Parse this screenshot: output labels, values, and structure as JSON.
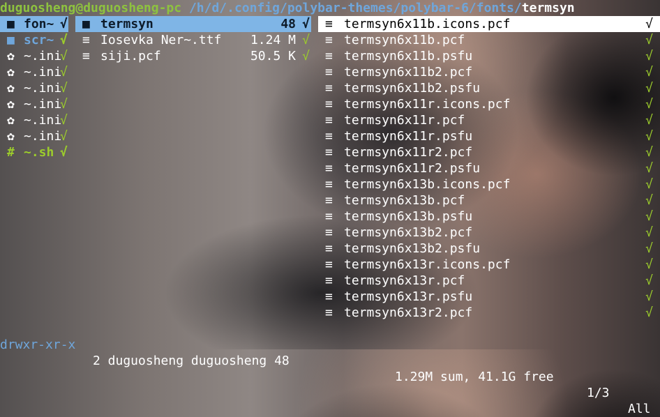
{
  "titlebar": {
    "user_host": "duguosheng@duguosheng-pc",
    "path": "/h/d/.config/polybar-themes/polybar-6/fonts/",
    "current": "termsyn"
  },
  "icons": {
    "folder": "folder-icon",
    "file": "file-icon",
    "gear": "gear-icon",
    "check": "check-icon"
  },
  "parent_column": [
    {
      "icon": "■",
      "name": "fon~",
      "check": "√",
      "kind": "dir hl"
    },
    {
      "icon": "■",
      "name": "scr~",
      "check": "√",
      "kind": "dir"
    },
    {
      "icon": "✿",
      "name": "~.ini",
      "check": "√",
      "kind": "ini"
    },
    {
      "icon": "✿",
      "name": "~.ini",
      "check": "√",
      "kind": "ini"
    },
    {
      "icon": "✿",
      "name": "~.ini",
      "check": "√",
      "kind": "ini"
    },
    {
      "icon": "✿",
      "name": "~.ini",
      "check": "√",
      "kind": "ini"
    },
    {
      "icon": "✿",
      "name": "~.ini",
      "check": "√",
      "kind": "ini"
    },
    {
      "icon": "✿",
      "name": "~.ini",
      "check": "√",
      "kind": "ini"
    },
    {
      "icon": "#",
      "name": "~.sh",
      "check": "√",
      "kind": "sh"
    }
  ],
  "current_column": [
    {
      "icon": "■",
      "name": "termsyn",
      "size": "48",
      "check": "√",
      "kind": "dir hl"
    },
    {
      "icon": "≡",
      "name": "Iosevka Ner~.ttf",
      "size": "1.24 M",
      "check": "√",
      "kind": "file"
    },
    {
      "icon": "≡",
      "name": "siji.pcf",
      "size": "50.5 K",
      "check": "√",
      "kind": "file"
    }
  ],
  "preview_column": [
    {
      "icon": "≡",
      "name": "termsyn6x11b.icons.pcf",
      "check": "√",
      "kind": "sel"
    },
    {
      "icon": "≡",
      "name": "termsyn6x11b.pcf",
      "check": "√",
      "kind": "file"
    },
    {
      "icon": "≡",
      "name": "termsyn6x11b.psfu",
      "check": "√",
      "kind": "file"
    },
    {
      "icon": "≡",
      "name": "termsyn6x11b2.pcf",
      "check": "√",
      "kind": "file"
    },
    {
      "icon": "≡",
      "name": "termsyn6x11b2.psfu",
      "check": "√",
      "kind": "file"
    },
    {
      "icon": "≡",
      "name": "termsyn6x11r.icons.pcf",
      "check": "√",
      "kind": "file"
    },
    {
      "icon": "≡",
      "name": "termsyn6x11r.pcf",
      "check": "√",
      "kind": "file"
    },
    {
      "icon": "≡",
      "name": "termsyn6x11r.psfu",
      "check": "√",
      "kind": "file"
    },
    {
      "icon": "≡",
      "name": "termsyn6x11r2.pcf",
      "check": "√",
      "kind": "file"
    },
    {
      "icon": "≡",
      "name": "termsyn6x11r2.psfu",
      "check": "√",
      "kind": "file"
    },
    {
      "icon": "≡",
      "name": "termsyn6x13b.icons.pcf",
      "check": "√",
      "kind": "file"
    },
    {
      "icon": "≡",
      "name": "termsyn6x13b.pcf",
      "check": "√",
      "kind": "file"
    },
    {
      "icon": "≡",
      "name": "termsyn6x13b.psfu",
      "check": "√",
      "kind": "file"
    },
    {
      "icon": "≡",
      "name": "termsyn6x13b2.pcf",
      "check": "√",
      "kind": "file"
    },
    {
      "icon": "≡",
      "name": "termsyn6x13b2.psfu",
      "check": "√",
      "kind": "file"
    },
    {
      "icon": "≡",
      "name": "termsyn6x13r.icons.pcf",
      "check": "√",
      "kind": "file"
    },
    {
      "icon": "≡",
      "name": "termsyn6x13r.pcf",
      "check": "√",
      "kind": "file"
    },
    {
      "icon": "≡",
      "name": "termsyn6x13r.psfu",
      "check": "√",
      "kind": "file"
    },
    {
      "icon": "≡",
      "name": "termsyn6x13r2.pcf",
      "check": "√",
      "kind": "file"
    }
  ],
  "statusbar": {
    "permissions": "drwxr-xr-x",
    "owner": "2 duguosheng duguosheng 48",
    "summary": "1.29M sum, 41.1G free",
    "page": "1/3",
    "position": "All"
  },
  "colors": {
    "green": "#8ec23f",
    "blue": "#6fa6db",
    "highlight": "#7fb5e6"
  }
}
